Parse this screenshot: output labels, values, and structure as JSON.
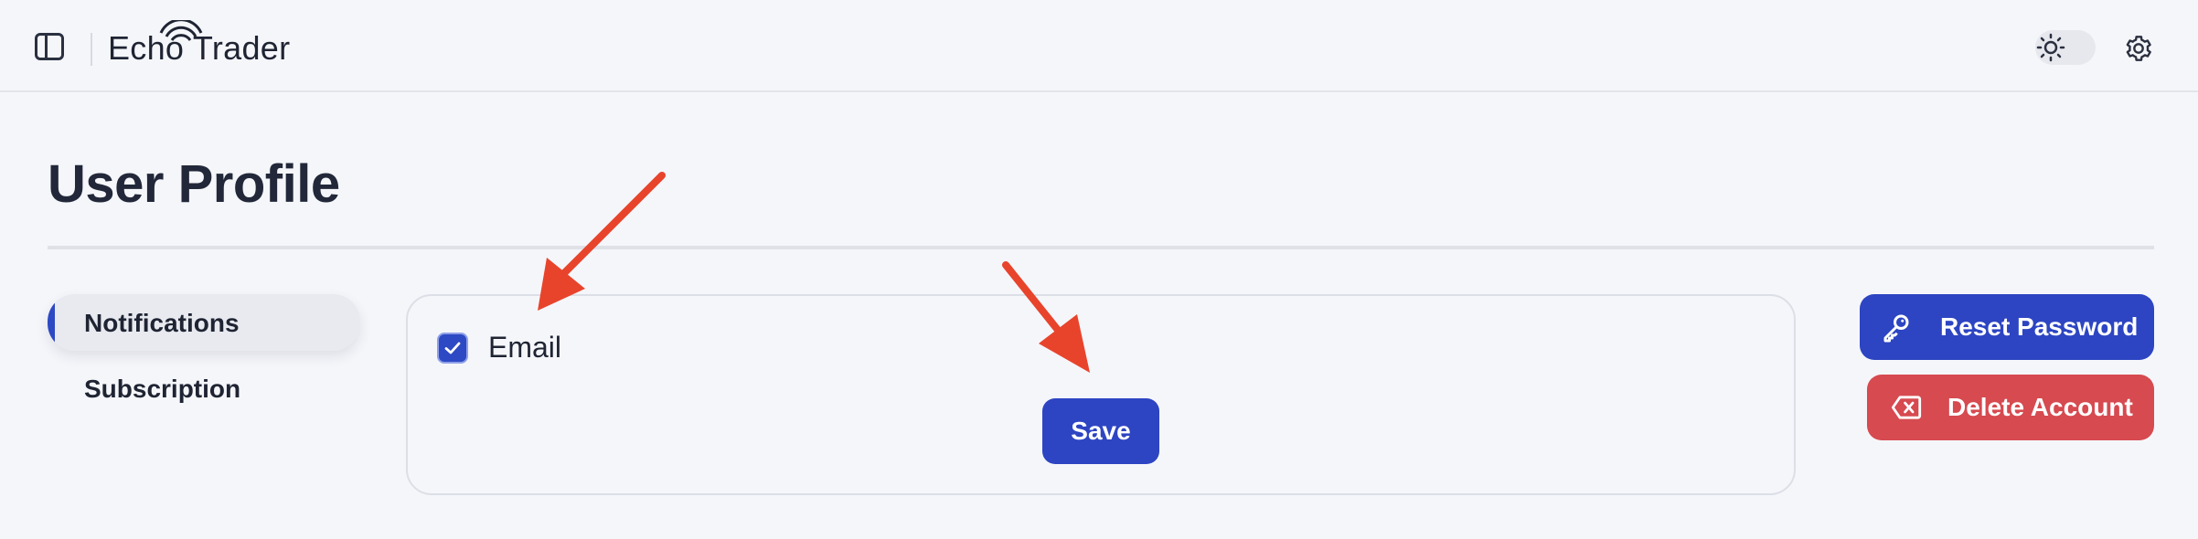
{
  "header": {
    "app_name": "Echo Trader",
    "icons": [
      "sidebar-toggle-icon",
      "sun-icon",
      "gear-icon"
    ]
  },
  "page": {
    "title": "User Profile"
  },
  "sidebar": {
    "items": [
      {
        "label": "Notifications",
        "active": true
      },
      {
        "label": "Subscription",
        "active": false
      }
    ]
  },
  "notifications": {
    "email_label": "Email",
    "email_checked": true,
    "save_label": "Save"
  },
  "actions": {
    "reset_password_label": "Reset Password",
    "delete_account_label": "Delete Account"
  },
  "colors": {
    "primary": "#2d45c2",
    "danger": "#d64a50",
    "annotation_arrow": "#e8442c"
  }
}
